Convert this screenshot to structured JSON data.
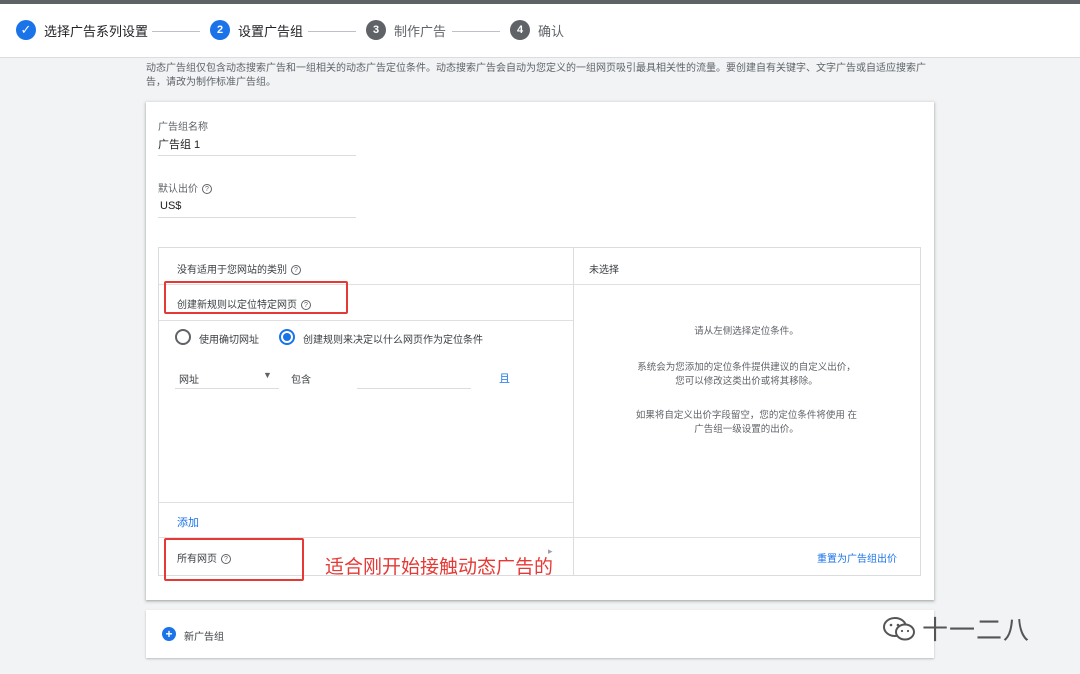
{
  "stepper": {
    "steps": [
      {
        "num": "✓",
        "label": "选择广告系列设置",
        "state": "done"
      },
      {
        "num": "2",
        "label": "设置广告组",
        "state": "active"
      },
      {
        "num": "3",
        "label": "制作广告",
        "state": "pending"
      },
      {
        "num": "4",
        "label": "确认",
        "state": "pending"
      }
    ]
  },
  "intro": {
    "text": "动态广告组仅包含动态搜索广告和一组相关的动态广告定位条件。动态搜索广告会自动为您定义的一组网页吸引最具相关性的流量。要创建自有关键字、文字广告或自适应搜索广告，请改为制作标准广告组。"
  },
  "ad_group": {
    "name_label": "广告组名称",
    "name_value": "广告组 1",
    "bid_label": "默认出价",
    "bid_value": "US$"
  },
  "targeting": {
    "no_category": "没有适用于您网站的类别",
    "create_rule": "创建新规则以定位特定网页",
    "radio_exact": "使用确切网址",
    "radio_rule": "创建规则来决定以什么网页作为定位条件",
    "condition_field": "网址",
    "condition_op": "包含",
    "and_link": "且",
    "add_link": "添加",
    "all_pages": "所有网页",
    "right_header": "未选择",
    "right_msg1": "请从左侧选择定位条件。",
    "right_msg2a": "系统会为您添加的定位条件提供建议的自定义出价，",
    "right_msg2b": "您可以修改这类出价或将其移除。",
    "right_msg3a": "如果将自定义出价字段留空，您的定位条件将使用 在",
    "right_msg3b": "广告组一级设置的出价。",
    "reset_link": "重置为广告组出价"
  },
  "annotation": {
    "text": "适合刚开始接触动态广告的"
  },
  "new_group": {
    "label": "新广告组"
  },
  "watermark": {
    "text": "十一二八"
  },
  "colors": {
    "accent": "#1a73e8",
    "annotation_red": "#e53935"
  }
}
